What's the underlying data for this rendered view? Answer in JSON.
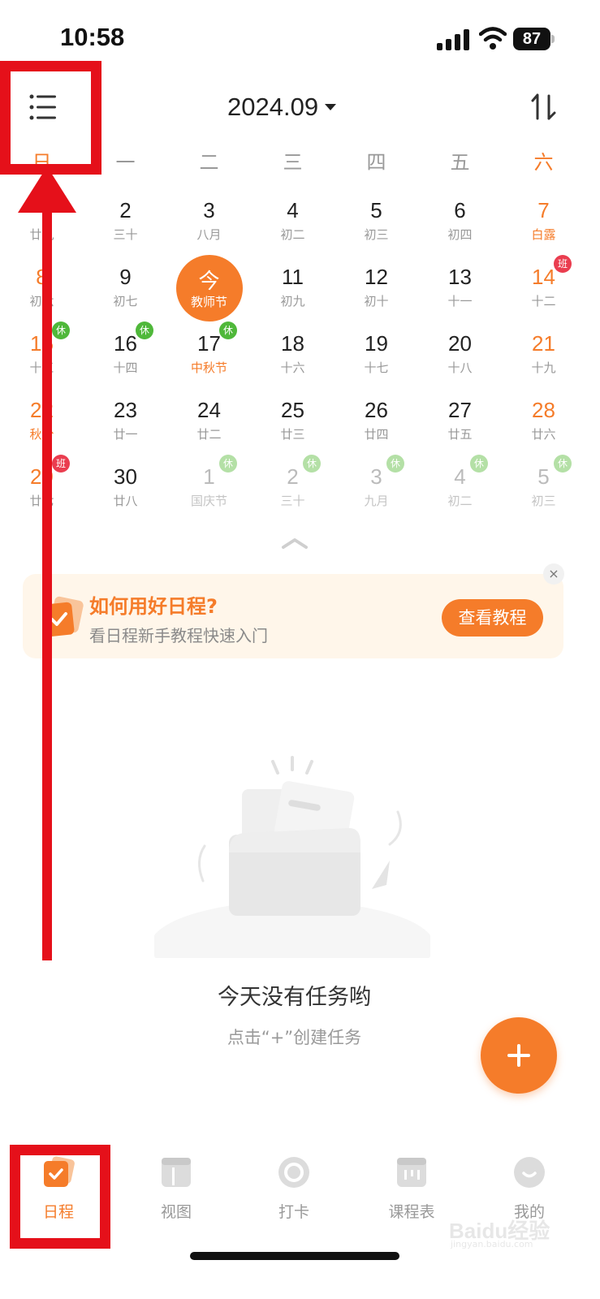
{
  "status_bar": {
    "time": "10:58",
    "battery": "87"
  },
  "header": {
    "month": "2024.09",
    "sort_icon_name": "sort-arrows-icon",
    "menu_icon_name": "list-menu-icon"
  },
  "weekdays": [
    "日",
    "一",
    "二",
    "三",
    "四",
    "五",
    "六"
  ],
  "calendar": {
    "weeks": [
      [
        {
          "num": "",
          "sub": "廿九",
          "weekend": true
        },
        {
          "num": "2",
          "sub": "三十"
        },
        {
          "num": "3",
          "sub": "八月"
        },
        {
          "num": "4",
          "sub": "初二"
        },
        {
          "num": "5",
          "sub": "初三"
        },
        {
          "num": "6",
          "sub": "初四"
        },
        {
          "num": "7",
          "sub": "白露",
          "weekend": true,
          "festival": true
        }
      ],
      [
        {
          "num": "8",
          "sub": "初六",
          "weekend": true
        },
        {
          "num": "9",
          "sub": "初七"
        },
        {
          "num": "今",
          "sub": "教师节",
          "today": true
        },
        {
          "num": "11",
          "sub": "初九"
        },
        {
          "num": "12",
          "sub": "初十"
        },
        {
          "num": "13",
          "sub": "十一"
        },
        {
          "num": "14",
          "sub": "十二",
          "weekend": true,
          "badge": "班",
          "badge_type": "work"
        }
      ],
      [
        {
          "num": "15",
          "sub": "十三",
          "weekend": true,
          "badge": "休",
          "badge_type": "rest"
        },
        {
          "num": "16",
          "sub": "十四",
          "badge": "休",
          "badge_type": "rest"
        },
        {
          "num": "17",
          "sub": "中秋节",
          "festival": true,
          "badge": "休",
          "badge_type": "rest"
        },
        {
          "num": "18",
          "sub": "十六"
        },
        {
          "num": "19",
          "sub": "十七"
        },
        {
          "num": "20",
          "sub": "十八"
        },
        {
          "num": "21",
          "sub": "十九",
          "weekend": true
        }
      ],
      [
        {
          "num": "22",
          "sub": "秋分",
          "weekend": true,
          "festival": true
        },
        {
          "num": "23",
          "sub": "廿一"
        },
        {
          "num": "24",
          "sub": "廿二"
        },
        {
          "num": "25",
          "sub": "廿三"
        },
        {
          "num": "26",
          "sub": "廿四"
        },
        {
          "num": "27",
          "sub": "廿五"
        },
        {
          "num": "28",
          "sub": "廿六",
          "weekend": true
        }
      ],
      [
        {
          "num": "29",
          "sub": "廿七",
          "weekend": true,
          "badge": "班",
          "badge_type": "work"
        },
        {
          "num": "30",
          "sub": "廿八"
        },
        {
          "num": "1",
          "sub": "国庆节",
          "dim": true,
          "badge": "休",
          "badge_type": "rest-light"
        },
        {
          "num": "2",
          "sub": "三十",
          "dim": true,
          "badge": "休",
          "badge_type": "rest-light"
        },
        {
          "num": "3",
          "sub": "九月",
          "dim": true,
          "badge": "休",
          "badge_type": "rest-light"
        },
        {
          "num": "4",
          "sub": "初二",
          "dim": true,
          "badge": "休",
          "badge_type": "rest-light"
        },
        {
          "num": "5",
          "sub": "初三",
          "dim": true,
          "badge": "休",
          "badge_type": "rest-light"
        }
      ]
    ]
  },
  "tip_card": {
    "title": "如何用好日程?",
    "subtitle": "看日程新手教程快速入门",
    "button": "查看教程",
    "close": "×"
  },
  "empty_state": {
    "title": "今天没有任务哟",
    "subtitle": "点击“+”创建任务"
  },
  "tabs": [
    {
      "label": "日程",
      "icon": "schedule-check-icon",
      "active": true
    },
    {
      "label": "视图",
      "icon": "view-layout-icon"
    },
    {
      "label": "打卡",
      "icon": "checkin-ring-icon"
    },
    {
      "label": "课程表",
      "icon": "timetable-icon"
    },
    {
      "label": "我的",
      "icon": "profile-smile-icon"
    }
  ],
  "colors": {
    "accent": "#f57c2a",
    "annotation": "#e5101a",
    "rest_badge": "#4fb83a",
    "work_badge": "#ea3d4f"
  },
  "watermark": {
    "main": "Baidu经验",
    "sub": "jingyan.baidu.com"
  }
}
